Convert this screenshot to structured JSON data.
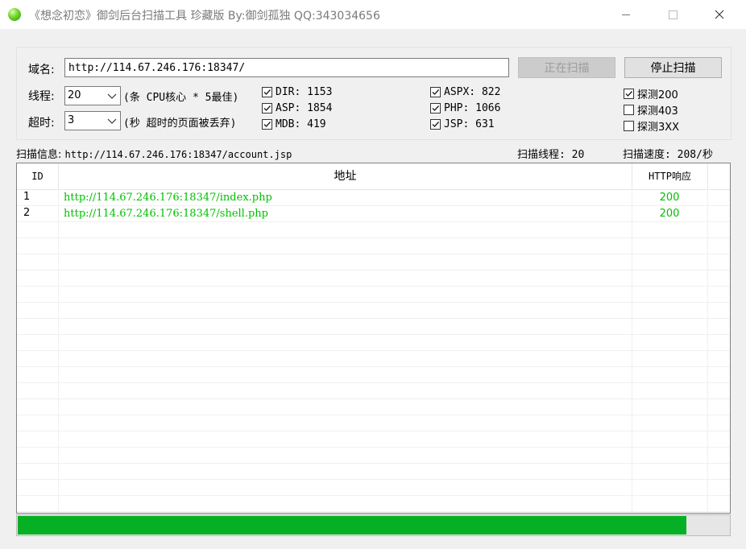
{
  "window": {
    "title": "《想念初恋》御剑后台扫描工具 珍藏版 By:御剑孤独 QQ:343034656"
  },
  "form": {
    "domain_label": "域名:",
    "domain_value": "http://114.67.246.176:18347/",
    "scanning_button": "正在扫描",
    "stop_button": "停止扫描",
    "threads_label": "线程:",
    "threads_value": "20",
    "threads_hint": "(条 CPU核心 * 5最佳)",
    "timeout_label": "超时:",
    "timeout_value": "3",
    "timeout_hint": "(秒 超时的页面被丢弃)"
  },
  "dictionaries": [
    {
      "label": "DIR: 1153",
      "checked": true
    },
    {
      "label": "ASP: 1854",
      "checked": true
    },
    {
      "label": "MDB: 419",
      "checked": true
    },
    {
      "label": "ASPX: 822",
      "checked": true
    },
    {
      "label": "PHP: 1066",
      "checked": true
    },
    {
      "label": "JSP: 631",
      "checked": true
    }
  ],
  "detect": [
    {
      "label": "探测200",
      "checked": true
    },
    {
      "label": "探测403",
      "checked": false
    },
    {
      "label": "探测3XX",
      "checked": false
    }
  ],
  "status": {
    "scan_info_label": "扫描信息:",
    "scan_info_value": "http://114.67.246.176:18347/account.jsp",
    "threads_text": "扫描线程: 20",
    "speed_text": "扫描速度: 208/秒"
  },
  "results": {
    "columns": [
      "ID",
      "地址",
      "HTTP响应"
    ],
    "rows": [
      {
        "id": "1",
        "url": "http://114.67.246.176:18347/index.php",
        "code": "200"
      },
      {
        "id": "2",
        "url": "http://114.67.246.176:18347/shell.php",
        "code": "200"
      }
    ]
  },
  "progress": {
    "fraction": 0.94
  },
  "colors": {
    "result_text": "#00c000",
    "progress_fill": "#06b025"
  }
}
